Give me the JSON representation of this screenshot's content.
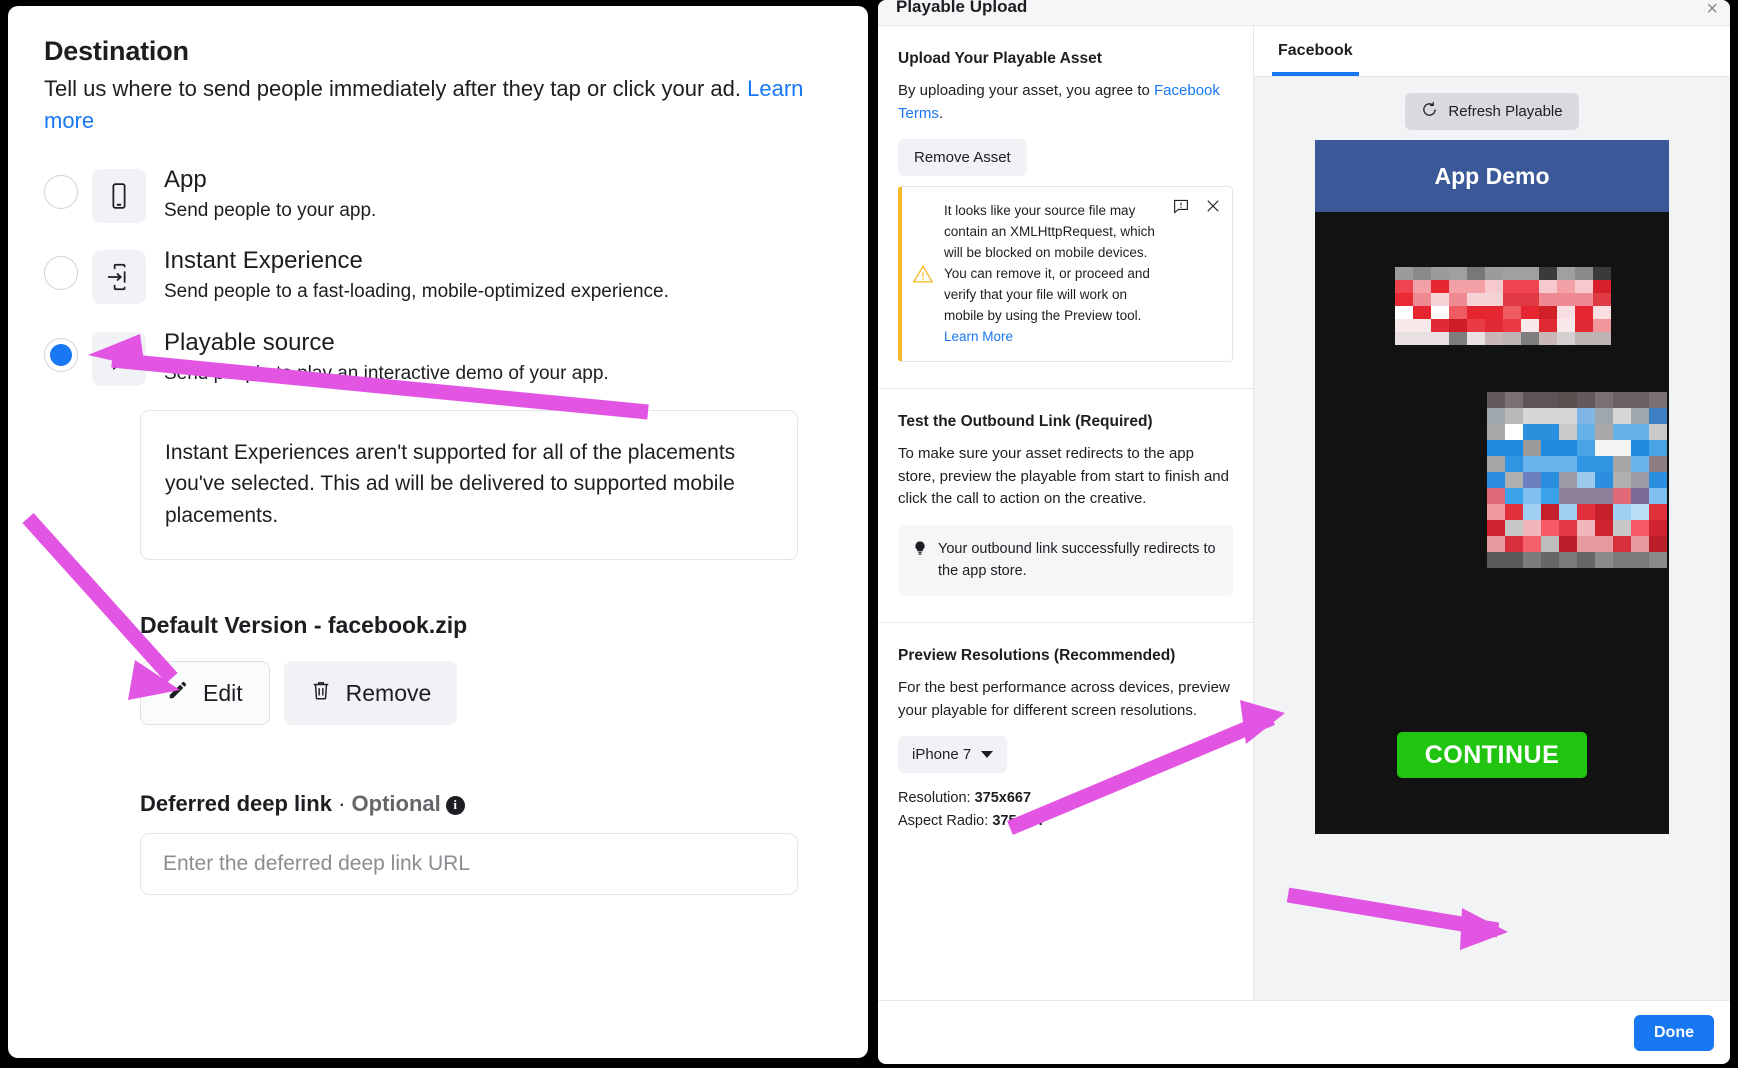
{
  "destination": {
    "title": "Destination",
    "subtitle_before": "Tell us where to send people immediately after they tap or click your ad. ",
    "learn_more": "Learn more",
    "options": [
      {
        "title": "App",
        "desc": "Send people to your app.",
        "icon": "phone-icon",
        "selected": false
      },
      {
        "title": "Instant Experience",
        "desc": "Send people to a fast-loading, mobile-optimized experience.",
        "icon": "instant-experience-icon",
        "selected": false
      },
      {
        "title": "Playable source",
        "desc": "Send people to play an interactive demo of your app.",
        "icon": "play-triangle-icon",
        "selected": true
      }
    ],
    "notice": "Instant Experiences aren't supported for all of the placements you've selected. This ad will be delivered to supported mobile placements.",
    "version_label": "Default Version - facebook.zip",
    "edit_label": "Edit",
    "remove_label": "Remove",
    "deep_link_label": "Deferred deep link",
    "deep_link_separator": " · ",
    "deep_link_optional": "Optional",
    "deep_link_placeholder": "Enter the deferred deep link URL",
    "deep_link_value": ""
  },
  "dialog": {
    "title": "Playable Upload",
    "close_label": "×",
    "upload": {
      "heading": "Upload Your Playable Asset",
      "agree_before": "By uploading your asset, you agree to ",
      "terms_link": "Facebook Terms",
      "agree_after": ".",
      "remove_asset_label": "Remove Asset",
      "warning_text": "It looks like your source file may contain an XMLHttpRequest, which will be blocked on mobile devices. You can remove it, or proceed and verify that your file will work on mobile by using the Preview tool. ",
      "warning_link": "Learn More"
    },
    "outbound": {
      "heading": "Test the Outbound Link (Required)",
      "body": "To make sure your asset redirects to the app store, preview the playable from start to finish and click the call to action on the creative.",
      "tip": "Your outbound link successfully redirects to the app store."
    },
    "resolutions": {
      "heading": "Preview Resolutions (Recommended)",
      "body": "For the best performance across devices, preview your playable for different screen resolutions.",
      "device_selected": "iPhone 7",
      "resolution_label": "Resolution: ",
      "resolution_value": "375x667",
      "aspect_label": "Aspect Radio: ",
      "aspect_value": "375:667"
    },
    "preview": {
      "tab_label": "Facebook",
      "refresh_label": "Refresh Playable",
      "phone_title": "App Demo",
      "continue_label": "CONTINUE"
    },
    "done_label": "Done"
  },
  "colors": {
    "accent_blue": "#1877f2",
    "arrow_magenta": "#e255e2",
    "warning_yellow": "#f7b928",
    "continue_green": "#22c412",
    "phone_header_blue": "#3b5998"
  }
}
